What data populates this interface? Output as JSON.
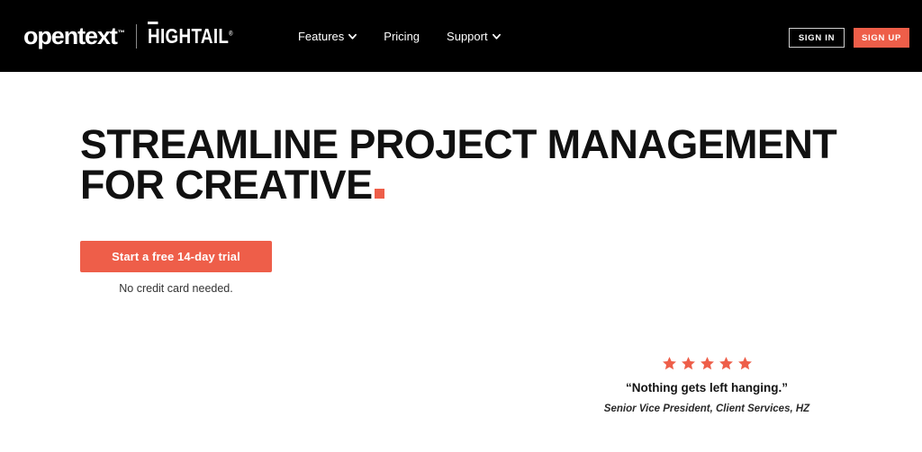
{
  "header": {
    "background_color": "#000000",
    "logo": {
      "brand_primary": "opentext",
      "brand_primary_mark": "™",
      "brand_secondary": "HIGHTAIL",
      "brand_secondary_mark": "®"
    },
    "nav": [
      {
        "label": "Features",
        "has_dropdown": true,
        "icon": "chevron-down-icon"
      },
      {
        "label": "Pricing",
        "has_dropdown": false,
        "icon": ""
      },
      {
        "label": "Support",
        "has_dropdown": true,
        "icon": "chevron-down-icon"
      }
    ],
    "auth": {
      "sign_in_label": "SIGN IN",
      "sign_up_label": "SIGN UP"
    }
  },
  "hero": {
    "headline_line1": "STREAMLINE PROJECT MANAGEMENT",
    "headline_line2": "FOR CREATIVE",
    "headline_accent_color": "#ee5e49",
    "cta_label": "Start a free 14-day trial",
    "cta_subtext": "No credit card needed."
  },
  "testimonial": {
    "rating": 5,
    "star_icon": "star-icon",
    "star_color": "#ee5e49",
    "quote": "“Nothing gets left hanging.”",
    "attribution": "Senior Vice President, Client Services, HZ"
  },
  "theme": {
    "accent": "#ee5e49",
    "header_bg": "#000000",
    "page_bg": "#ffffff",
    "text_dark": "#111111"
  }
}
